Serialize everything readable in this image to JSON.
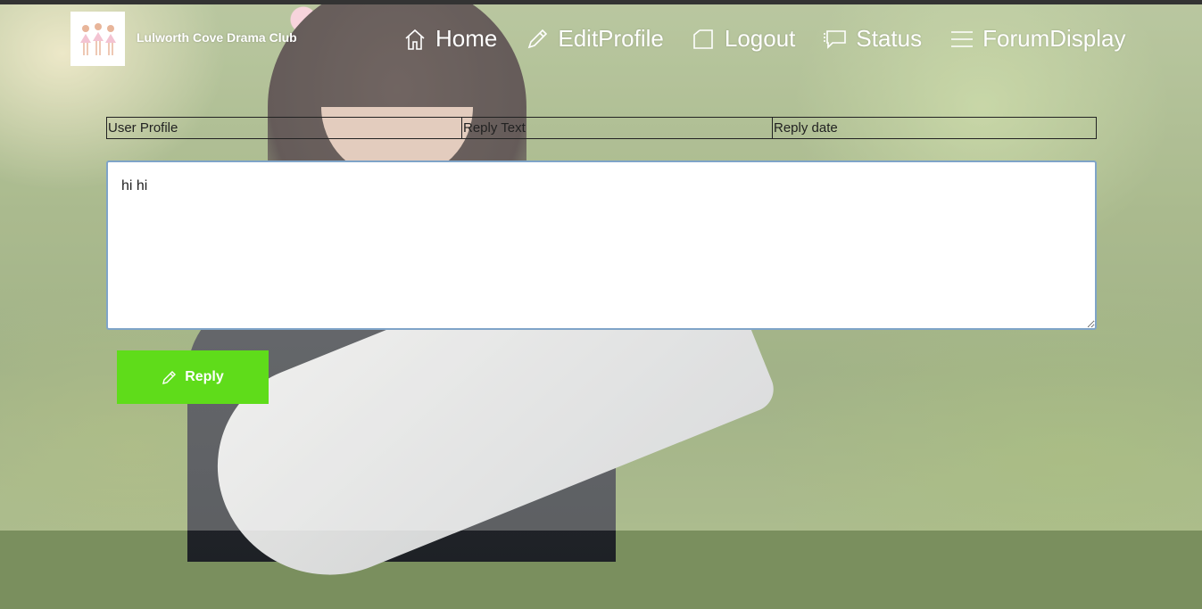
{
  "header": {
    "brand": "Lulworth Cove Drama Club",
    "nav": [
      {
        "label": "Home",
        "icon": "home-icon"
      },
      {
        "label": "EditProfile",
        "icon": "pencil-icon"
      },
      {
        "label": "Logout",
        "icon": "logout-icon"
      },
      {
        "label": "Status",
        "icon": "chat-icon"
      },
      {
        "label": "ForumDisplay",
        "icon": "menu-icon"
      }
    ]
  },
  "table": {
    "columns": [
      "User Profile",
      "Reply Text",
      "Reply date"
    ]
  },
  "reply": {
    "text": "hi hi",
    "button_label": "Reply",
    "button_icon": "pencil-icon",
    "button_color": "#5fdc1a"
  }
}
